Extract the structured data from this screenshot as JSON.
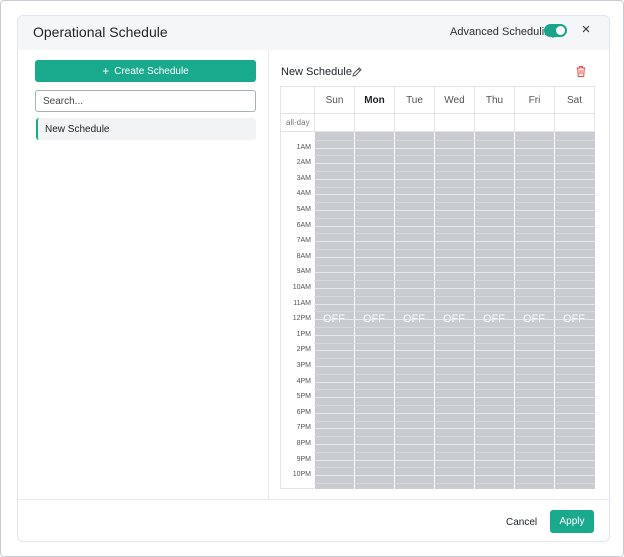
{
  "header": {
    "title": "Operational Schedule",
    "advanced_label": "Advanced Scheduling",
    "advanced_enabled": true,
    "close_glyph": "×"
  },
  "sidebar": {
    "create_label": "Create Schedule",
    "search_placeholder": "Search...",
    "schedules": [
      {
        "name": "New Schedule",
        "selected": true
      }
    ]
  },
  "editor": {
    "schedule_name": "New Schedule",
    "days": [
      "Sun",
      "Mon",
      "Tue",
      "Wed",
      "Thu",
      "Fri",
      "Sat"
    ],
    "today_index": 1,
    "allday_label": "all-day",
    "hours": [
      "1AM",
      "2AM",
      "3AM",
      "4AM",
      "5AM",
      "6AM",
      "7AM",
      "8AM",
      "9AM",
      "10AM",
      "11AM",
      "12PM",
      "1PM",
      "2PM",
      "3PM",
      "4PM",
      "5PM",
      "6PM",
      "7PM",
      "8PM",
      "9PM",
      "10PM"
    ],
    "off_label": "OFF"
  },
  "footer": {
    "cancel_label": "Cancel",
    "apply_label": "Apply"
  },
  "colors": {
    "accent": "#19a98c",
    "off_block": "#c8ccd0"
  }
}
